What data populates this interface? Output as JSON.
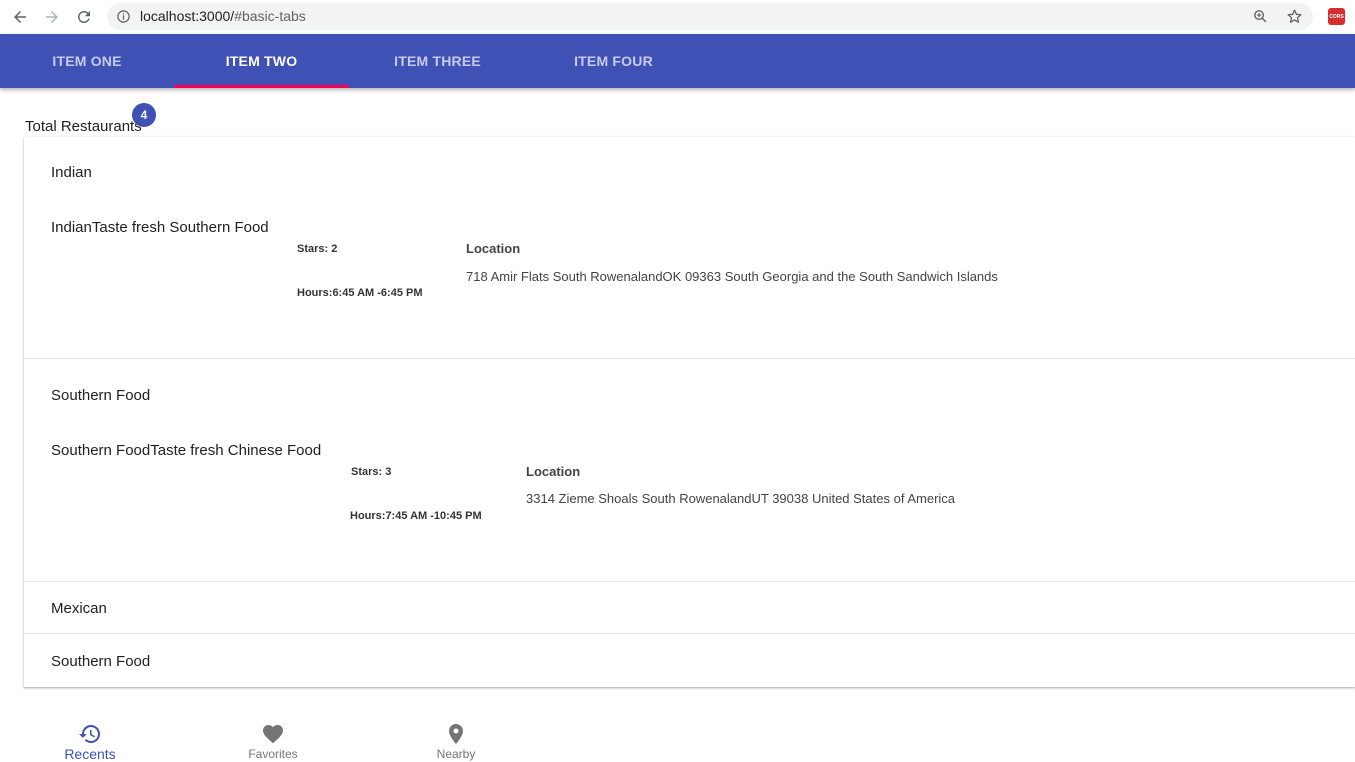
{
  "browser": {
    "url_host": "localhost:3000/",
    "url_path": "#basic-tabs",
    "extension_label": "CORS"
  },
  "tabs": [
    {
      "label": "Item One",
      "active": false
    },
    {
      "label": "Item Two",
      "active": true
    },
    {
      "label": "Item Three",
      "active": false
    },
    {
      "label": "Item Four",
      "active": false
    }
  ],
  "summary": {
    "label": "Total Restaurants",
    "count": "4"
  },
  "restaurants": [
    {
      "title": "Indian",
      "detail_title": "IndianTaste fresh Southern Food",
      "stars": "Stars: 2",
      "hours": "Hours:6:45 AM -6:45 PM",
      "location_label": "Location",
      "location": "718 Amir Flats South RowenalandOK 09363 South Georgia and the South Sandwich Islands"
    },
    {
      "title": "Southern Food",
      "detail_title": "Southern FoodTaste fresh Chinese Food",
      "stars": "Stars: 3",
      "hours": "Hours:7:45 AM -10:45 PM",
      "location_label": "Location",
      "location": "3314 Zieme Shoals South RowenalandUT 39038 United States of America"
    },
    {
      "title": "Mexican"
    },
    {
      "title": "Southern Food"
    }
  ],
  "bottom_nav": [
    {
      "label": "Recents",
      "icon": "history-icon",
      "active": true
    },
    {
      "label": "Favorites",
      "icon": "heart-icon",
      "active": false
    },
    {
      "label": "Nearby",
      "icon": "location-pin-icon",
      "active": false
    }
  ],
  "colors": {
    "primary": "#3f51b5",
    "indicator": "#f50057"
  }
}
